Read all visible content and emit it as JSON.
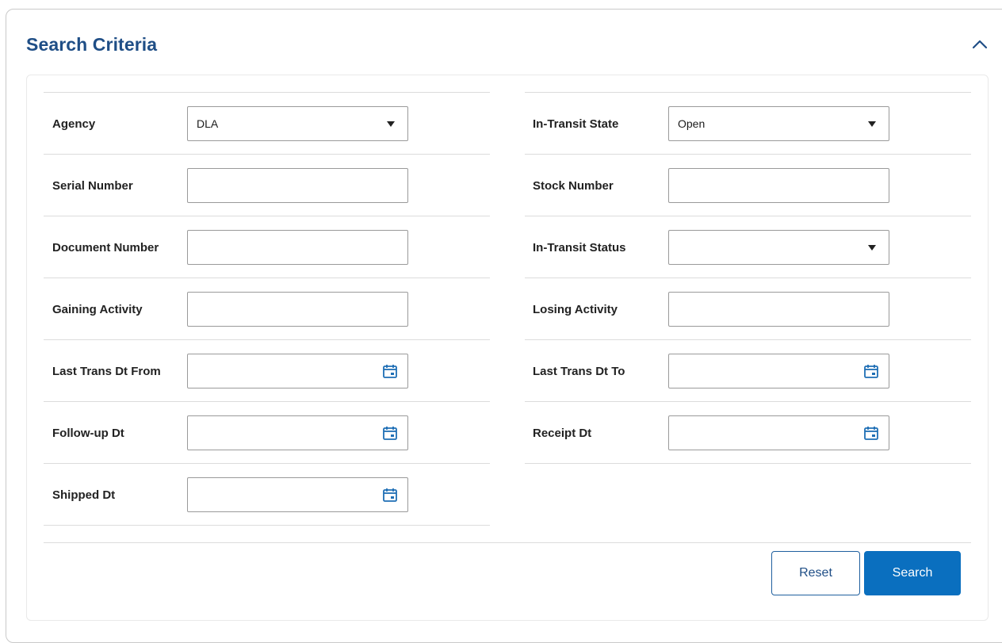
{
  "panel": {
    "title": "Search Criteria",
    "collapse_icon": "chevron-up-icon"
  },
  "left_fields": [
    {
      "label": "Agency",
      "type": "select",
      "value": "DLA"
    },
    {
      "label": "Serial Number",
      "type": "text",
      "value": ""
    },
    {
      "label": "Document Number",
      "type": "text",
      "value": ""
    },
    {
      "label": "Gaining Activity",
      "type": "text",
      "value": ""
    },
    {
      "label": "Last Trans Dt From",
      "type": "date",
      "value": ""
    },
    {
      "label": "Follow-up Dt",
      "type": "date",
      "value": ""
    },
    {
      "label": "Shipped Dt",
      "type": "date",
      "value": ""
    }
  ],
  "right_fields": [
    {
      "label": "In-Transit State",
      "type": "select",
      "value": "Open"
    },
    {
      "label": "Stock Number",
      "type": "text",
      "value": ""
    },
    {
      "label": "In-Transit Status",
      "type": "select",
      "value": ""
    },
    {
      "label": "Losing Activity",
      "type": "text",
      "value": ""
    },
    {
      "label": "Last Trans Dt To",
      "type": "date",
      "value": ""
    },
    {
      "label": "Receipt Dt",
      "type": "date",
      "value": ""
    }
  ],
  "actions": {
    "reset_label": "Reset",
    "search_label": "Search"
  },
  "colors": {
    "title": "#1f4e86",
    "primary_button": "#0a6fbf",
    "calendar_icon": "#1f6fb5"
  }
}
